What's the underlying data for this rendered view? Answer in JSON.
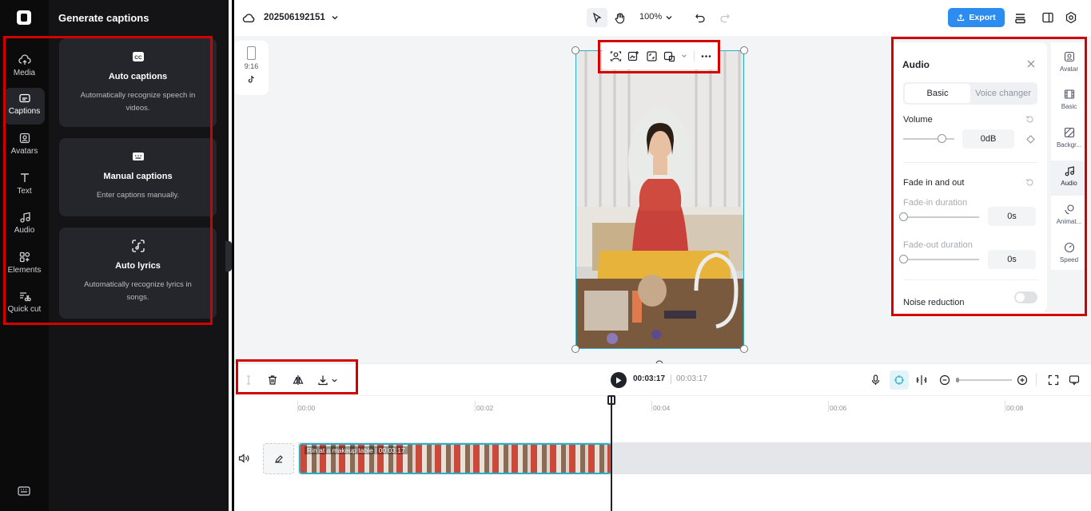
{
  "rail": {
    "items": [
      {
        "label": "Media"
      },
      {
        "label": "Captions"
      },
      {
        "label": "Avatars"
      },
      {
        "label": "Text"
      },
      {
        "label": "Audio"
      },
      {
        "label": "Elements"
      },
      {
        "label": "Quick cut"
      }
    ]
  },
  "panel": {
    "title": "Generate captions",
    "cards": [
      {
        "title": "Auto captions",
        "desc": "Automatically recognize speech in videos."
      },
      {
        "title": "Manual captions",
        "desc": "Enter captions manually."
      },
      {
        "title": "Auto lyrics",
        "desc": "Automatically recognize lyrics in songs."
      }
    ]
  },
  "header": {
    "project_name": "202506192151",
    "zoom": "100%",
    "export_label": "Export"
  },
  "canvas": {
    "ratio_label": "9:16"
  },
  "audio": {
    "title": "Audio",
    "tabs": [
      "Basic",
      "Voice changer"
    ],
    "volume_label": "Volume",
    "volume_value": "0dB",
    "fade_label": "Fade in and out",
    "fade_in_label": "Fade-in duration",
    "fade_in_value": "0s",
    "fade_out_label": "Fade-out duration",
    "fade_out_value": "0s",
    "noise_label": "Noise reduction"
  },
  "right_tabs": [
    "Avatar",
    "Basic",
    "Backgr...",
    "Audio",
    "Animat...",
    "Speed"
  ],
  "timeline": {
    "current_time": "00:03:17",
    "total_time": "00:03:17",
    "ticks": [
      "00:00",
      "00:02",
      "00:04",
      "00:06",
      "00:08"
    ],
    "clip_title": "Rin at a makeup table",
    "clip_duration": "00:03:17"
  },
  "colors": {
    "accent": "#2d8cf0",
    "selection": "#27b0c9",
    "highlight": "#d40000"
  }
}
